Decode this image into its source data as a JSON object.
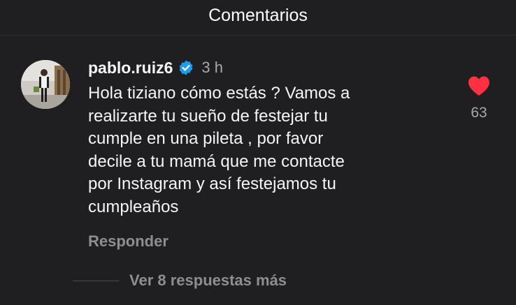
{
  "header": {
    "title": "Comentarios"
  },
  "comment": {
    "username": "pablo.ruiz6",
    "verified": true,
    "time": "3 h",
    "text": "Hola tiziano cómo estás ? Vamos a\nrealizarte tu sueño de festejar tu\ncumple en una pileta , por favor\ndecile a tu mamá que me contacte\npor Instagram y así festejamos tu\ncumpleaños",
    "reply_label": "Responder",
    "like_count": "63",
    "liked": true
  },
  "replies": {
    "label": "Ver 8 respuestas más"
  },
  "colors": {
    "background": "#1f1f22",
    "verified_badge": "#1d9bf0",
    "heart": "#ff3040",
    "muted_text": "#8e8e8e"
  },
  "icons": [
    "verified-badge-icon",
    "heart-icon"
  ]
}
